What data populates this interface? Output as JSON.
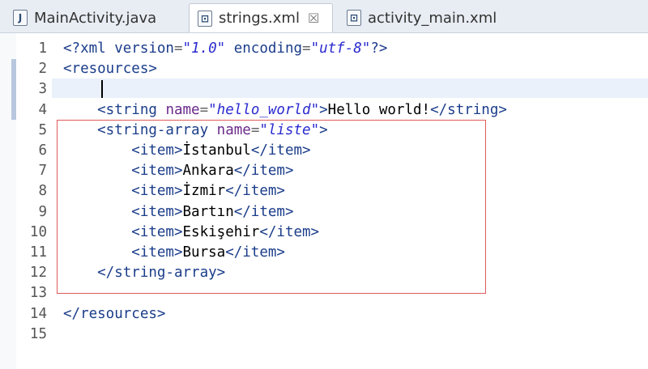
{
  "tabs": [
    {
      "icon": "J",
      "label": "MainActivity.java",
      "active": false
    },
    {
      "icon": "⊡",
      "label": "strings.xml",
      "active": true,
      "close": "☒"
    },
    {
      "icon": "⊡",
      "label": "activity_main.xml",
      "active": false
    }
  ],
  "lines": [
    {
      "num": "1",
      "tokens": [
        {
          "t": "<?xml version",
          "c": "t"
        },
        {
          "t": "=",
          "c": "e"
        },
        {
          "t": "\"1.0\"",
          "c": "v"
        },
        {
          "t": " encoding",
          "c": "t"
        },
        {
          "t": "=",
          "c": "e"
        },
        {
          "t": "\"utf-8\"",
          "c": "v"
        },
        {
          "t": "?>",
          "c": "t"
        }
      ]
    },
    {
      "num": "2",
      "tokens": [
        {
          "t": "<resources>",
          "c": "t"
        }
      ]
    },
    {
      "num": "3",
      "tokens": []
    },
    {
      "num": "4",
      "tokens": [
        {
          "t": "    <string ",
          "c": "t"
        },
        {
          "t": "name",
          "c": "a"
        },
        {
          "t": "=",
          "c": "e"
        },
        {
          "t": "\"hello_world\"",
          "c": "v"
        },
        {
          "t": ">",
          "c": "t"
        },
        {
          "t": "Hello world!",
          "c": "txt"
        },
        {
          "t": "</string>",
          "c": "t"
        }
      ]
    },
    {
      "num": "5",
      "tokens": [
        {
          "t": "    <string-array ",
          "c": "t"
        },
        {
          "t": "name",
          "c": "a"
        },
        {
          "t": "=",
          "c": "e"
        },
        {
          "t": "\"liste\"",
          "c": "v"
        },
        {
          "t": ">",
          "c": "t"
        }
      ]
    },
    {
      "num": "6",
      "tokens": [
        {
          "t": "        <item>",
          "c": "t"
        },
        {
          "t": "İstanbul",
          "c": "txt"
        },
        {
          "t": "</item>",
          "c": "t"
        }
      ]
    },
    {
      "num": "7",
      "tokens": [
        {
          "t": "        <item>",
          "c": "t"
        },
        {
          "t": "Ankara",
          "c": "txt"
        },
        {
          "t": "</item>",
          "c": "t"
        }
      ]
    },
    {
      "num": "8",
      "tokens": [
        {
          "t": "        <item>",
          "c": "t"
        },
        {
          "t": "İzmir",
          "c": "txt"
        },
        {
          "t": "</item>",
          "c": "t"
        }
      ]
    },
    {
      "num": "9",
      "tokens": [
        {
          "t": "        <item>",
          "c": "t"
        },
        {
          "t": "Bartın",
          "c": "txt"
        },
        {
          "t": "</item>",
          "c": "t"
        }
      ]
    },
    {
      "num": "10",
      "tokens": [
        {
          "t": "        <item>",
          "c": "t"
        },
        {
          "t": "Eskişehir",
          "c": "txt"
        },
        {
          "t": "</item>",
          "c": "t"
        }
      ]
    },
    {
      "num": "11",
      "tokens": [
        {
          "t": "        <item>",
          "c": "t"
        },
        {
          "t": "Bursa",
          "c": "txt"
        },
        {
          "t": "</item>",
          "c": "t"
        }
      ]
    },
    {
      "num": "12",
      "tokens": [
        {
          "t": "    </string-array>",
          "c": "t"
        }
      ]
    },
    {
      "num": "13",
      "tokens": []
    },
    {
      "num": "14",
      "tokens": [
        {
          "t": "</resources>",
          "c": "t"
        }
      ]
    },
    {
      "num": "15",
      "tokens": []
    }
  ],
  "colors": {
    "highlight_box": "#e05a5a",
    "tag": "#1b3d8a",
    "value": "#2a2ad0"
  }
}
